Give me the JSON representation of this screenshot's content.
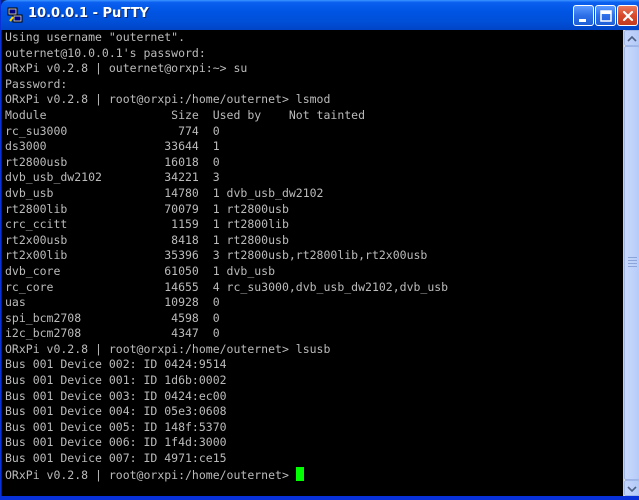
{
  "window": {
    "title": "10.0.0.1 - PuTTY",
    "icon": "putty-icon",
    "controls": [
      "minimize-icon",
      "maximize-icon",
      "close-icon"
    ]
  },
  "terminal": {
    "background": "#000000",
    "foreground": "#bbbbbb",
    "cursor_color": "#00ff00",
    "lines": [
      "Using username \"outernet\".",
      "outernet@10.0.0.1's password:",
      "ORxPi v0.2.8 | outernet@orxpi:~> su",
      "Password:",
      "ORxPi v0.2.8 | root@orxpi:/home/outernet> lsmod",
      "Module                  Size  Used by    Not tainted",
      "rc_su3000                774  0",
      "ds3000                 33644  1",
      "rt2800usb              16018  0",
      "dvb_usb_dw2102         34221  3",
      "dvb_usb                14780  1 dvb_usb_dw2102",
      "rt2800lib              70079  1 rt2800usb",
      "crc_ccitt               1159  1 rt2800lib",
      "rt2x00usb               8418  1 rt2800usb",
      "rt2x00lib              35396  3 rt2800usb,rt2800lib,rt2x00usb",
      "dvb_core               61050  1 dvb_usb",
      "rc_core                14655  4 rc_su3000,dvb_usb_dw2102,dvb_usb",
      "uas                    10928  0",
      "spi_bcm2708             4598  0",
      "i2c_bcm2708             4347  0",
      "ORxPi v0.2.8 | root@orxpi:/home/outernet> lsusb",
      "Bus 001 Device 002: ID 0424:9514",
      "Bus 001 Device 001: ID 1d6b:0002",
      "Bus 001 Device 003: ID 0424:ec00",
      "Bus 001 Device 004: ID 05e3:0608",
      "Bus 001 Device 005: ID 148f:5370",
      "Bus 001 Device 006: ID 1f4d:3000",
      "Bus 001 Device 007: ID 4971:ce15"
    ],
    "prompt": "ORxPi v0.2.8 | root@orxpi:/home/outernet> "
  }
}
